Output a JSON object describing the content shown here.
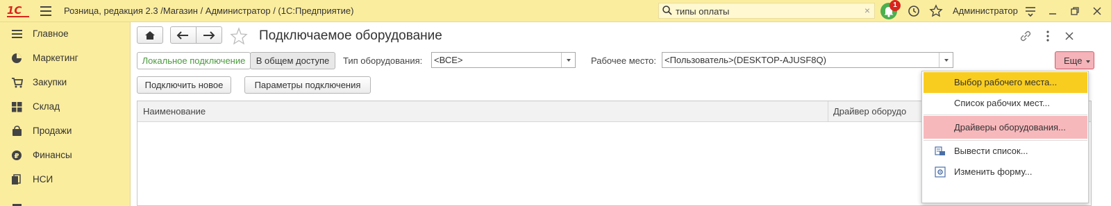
{
  "app": {
    "logo_text": "1С",
    "title": "Розница, редакция 2.3 /Магазин / Администратор /  (1С:Предприятие)"
  },
  "search": {
    "value": "типы оплаты",
    "clear_glyph": "×"
  },
  "notifications": {
    "count": "1"
  },
  "user": {
    "name": "Администратор"
  },
  "sidebar": {
    "items": [
      {
        "label": "Главное",
        "icon": "menu-lines-icon"
      },
      {
        "label": "Маркетинг",
        "icon": "pie-chart-icon"
      },
      {
        "label": "Закупки",
        "icon": "cart-icon"
      },
      {
        "label": "Склад",
        "icon": "grid-icon"
      },
      {
        "label": "Продажи",
        "icon": "bag-icon"
      },
      {
        "label": "Финансы",
        "icon": "coin-icon"
      },
      {
        "label": "НСИ",
        "icon": "books-icon"
      }
    ]
  },
  "page": {
    "title": "Подключаемое оборудование"
  },
  "filters": {
    "local_tab": "Локальное подключение",
    "shared_tab": "В общем доступе",
    "type_label": "Тип оборудования:",
    "type_value": "<ВСЕ>",
    "workplace_label": "Рабочее место:",
    "workplace_value": "<Пользователь>(DESKTOP-AJUSF8Q)",
    "more_button": "Еще"
  },
  "actions": {
    "connect_new": "Подключить новое",
    "connection_params": "Параметры подключения"
  },
  "table": {
    "columns": [
      "Наименование",
      "Драйвер оборудо"
    ]
  },
  "more_menu": {
    "items": [
      {
        "label": "Выбор рабочего места...",
        "state": "highlighted"
      },
      {
        "label": "Список рабочих мест...",
        "state": "normal"
      },
      {
        "label": "Драйверы оборудования...",
        "state": "pink"
      },
      {
        "label": "Вывести список...",
        "state": "normal",
        "icon": "print-list-icon"
      },
      {
        "label": "Изменить форму...",
        "state": "normal",
        "icon": "form-settings-icon"
      }
    ]
  },
  "colors": {
    "header_bg": "#fbed9e",
    "active_tab_text": "#4a9a3e",
    "menu_highlight": "#f9cd20",
    "menu_pink": "#f7b8bc",
    "logo_red": "#d9251d"
  }
}
